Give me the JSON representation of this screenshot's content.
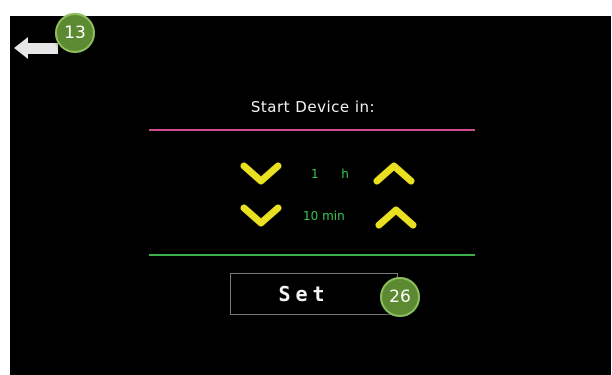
{
  "header": {
    "back_icon": "back-arrow-icon",
    "annotation_back": "13"
  },
  "main": {
    "title": "Start Device in:",
    "hours": {
      "value": "1",
      "unit": "h"
    },
    "minutes": {
      "value": "10",
      "unit": "min"
    },
    "decrease_icon": "chevron-down-icon",
    "increase_icon": "chevron-up-icon",
    "set_label": "Set",
    "annotation_set": "26"
  },
  "colors": {
    "background": "#000000",
    "accent_top_line": "#d04a90",
    "accent_bottom_line": "#3cae4a",
    "arrow": "#e8e020",
    "value_text": "#39c552",
    "callout": "#5b8a32"
  }
}
